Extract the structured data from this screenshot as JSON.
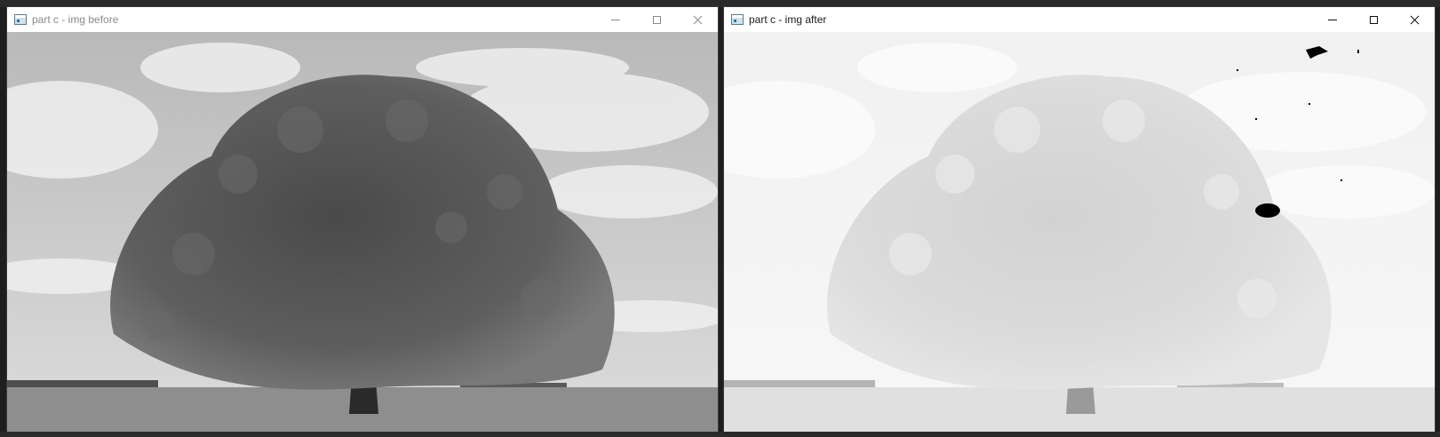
{
  "windows": [
    {
      "title": "part c - img before",
      "state": "inactive",
      "image_description": "grayscale"
    },
    {
      "title": "part c - img after",
      "state": "active",
      "image_description": "brightened grayscale"
    }
  ],
  "icons": {
    "app": "app-window-icon",
    "minimize": "minimize-icon",
    "maximize": "maximize-icon",
    "close": "close-icon"
  },
  "colors": {
    "desktop": "#1e1e1e",
    "titlebar": "#ffffff",
    "title_active": "#1a1a1a",
    "title_inactive": "#8a8a8a"
  }
}
